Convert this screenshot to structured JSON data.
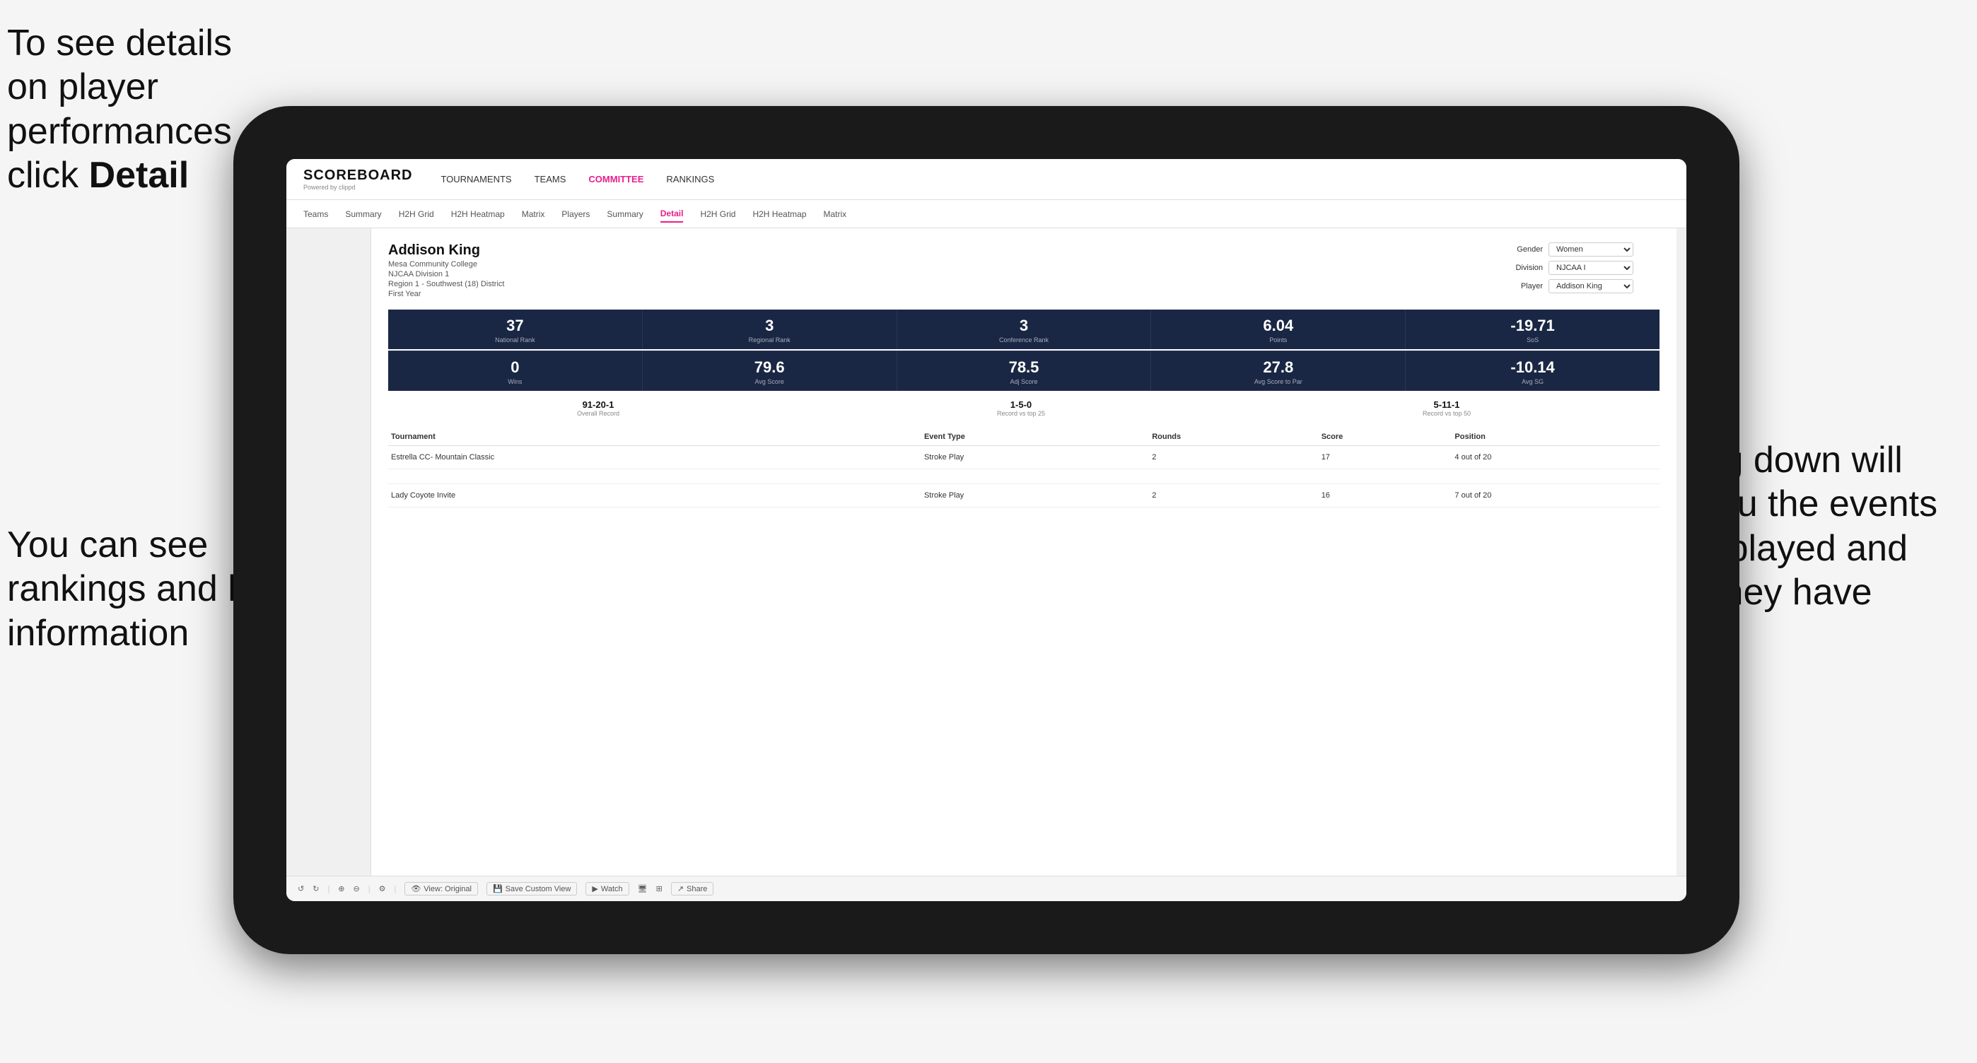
{
  "annotations": {
    "top_left": "To see details on player performances click ",
    "top_left_bold": "Detail",
    "middle_left": "You can see rankings and key information",
    "right": "Scrolling down will show you the events they've played and where they have finished"
  },
  "nav": {
    "logo": "SCOREBOARD",
    "logo_sub": "Powered by clippd",
    "items": [
      "TOURNAMENTS",
      "TEAMS",
      "COMMITTEE",
      "RANKINGS"
    ]
  },
  "sub_nav": {
    "items": [
      "Teams",
      "Summary",
      "H2H Grid",
      "H2H Heatmap",
      "Matrix",
      "Players",
      "Summary",
      "Detail",
      "H2H Grid",
      "H2H Heatmap",
      "Matrix"
    ]
  },
  "player": {
    "name": "Addison King",
    "college": "Mesa Community College",
    "division": "NJCAA Division 1",
    "region": "Region 1 - Southwest (18) District",
    "year": "First Year"
  },
  "controls": {
    "gender_label": "Gender",
    "gender_value": "Women",
    "division_label": "Division",
    "division_value": "NJCAA I",
    "player_label": "Player",
    "player_value": "Addison King"
  },
  "stats_row1": [
    {
      "value": "37",
      "label": "National Rank"
    },
    {
      "value": "3",
      "label": "Regional Rank"
    },
    {
      "value": "3",
      "label": "Conference Rank"
    },
    {
      "value": "6.04",
      "label": "Points"
    },
    {
      "value": "-19.71",
      "label": "SoS"
    }
  ],
  "stats_row2": [
    {
      "value": "0",
      "label": "Wins"
    },
    {
      "value": "79.6",
      "label": "Avg Score"
    },
    {
      "value": "78.5",
      "label": "Adj Score"
    },
    {
      "value": "27.8",
      "label": "Avg Score to Par"
    },
    {
      "value": "-10.14",
      "label": "Avg SG"
    }
  ],
  "records": [
    {
      "value": "91-20-1",
      "label": "Overall Record"
    },
    {
      "value": "1-5-0",
      "label": "Record vs top 25"
    },
    {
      "value": "5-11-1",
      "label": "Record vs top 50"
    }
  ],
  "table": {
    "headers": [
      "Tournament",
      "Event Type",
      "Rounds",
      "Score",
      "Position"
    ],
    "rows": [
      {
        "tournament": "Estrella CC- Mountain Classic",
        "event_type": "Stroke Play",
        "rounds": "2",
        "score": "17",
        "position": "4 out of 20"
      },
      {
        "tournament": "Lady Coyote Invite",
        "event_type": "Stroke Play",
        "rounds": "2",
        "score": "16",
        "position": "7 out of 20"
      }
    ]
  },
  "toolbar": {
    "view_original": "View: Original",
    "save_custom": "Save Custom View",
    "watch": "Watch",
    "share": "Share"
  }
}
